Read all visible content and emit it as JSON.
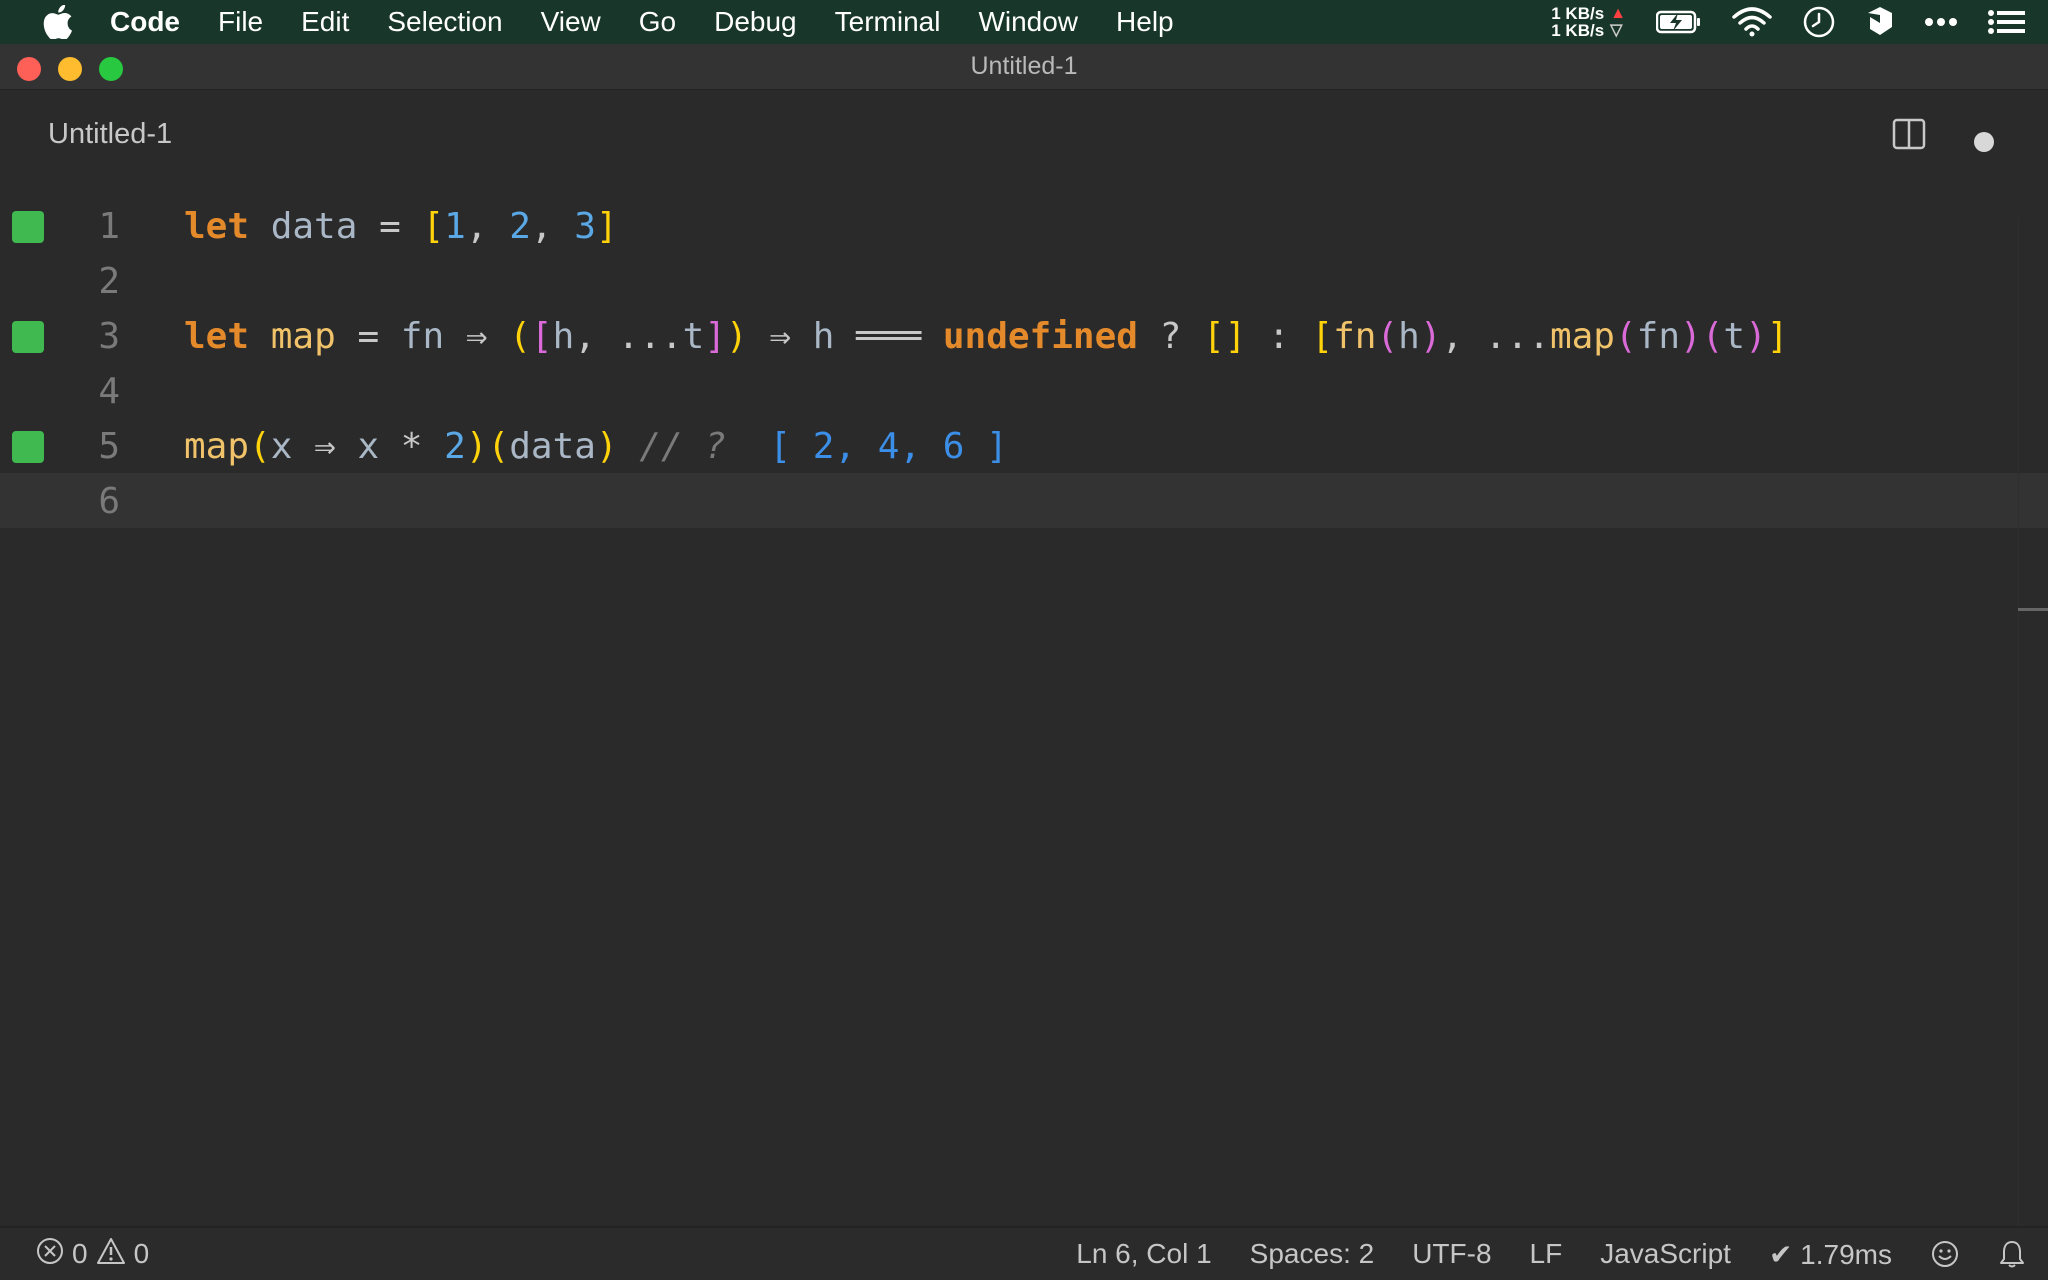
{
  "menubar": {
    "app_name": "Code",
    "items": [
      "File",
      "Edit",
      "Selection",
      "View",
      "Go",
      "Debug",
      "Terminal",
      "Window",
      "Help"
    ],
    "net_up": "1 KB/s",
    "net_down": "1 KB/s"
  },
  "window": {
    "title": "Untitled-1",
    "tab_label": "Untitled-1"
  },
  "editor": {
    "line_numbers": [
      "1",
      "2",
      "3",
      "4",
      "5",
      "6"
    ],
    "current_line": 6,
    "gutter_marks": [
      1,
      3,
      5
    ],
    "language_preview": {
      "line1": "let data = [1, 2, 3]",
      "line3": "let map = fn ⇒ ([h, ...t]) ⇒ h ═══ undefined ? [] : [fn(h), ...map(fn)(t)]",
      "line5": "map(x ⇒ x * 2)(data) // ?  [ 2, 4, 6 ]"
    },
    "result_annotation": "[ 2, 4, 6 ]"
  },
  "statusbar": {
    "errors": "0",
    "warnings": "0",
    "cursor": "Ln 6, Col 1",
    "spaces": "Spaces: 2",
    "encoding": "UTF-8",
    "eol": "LF",
    "language": "JavaScript",
    "timing": "✔ 1.79ms"
  }
}
